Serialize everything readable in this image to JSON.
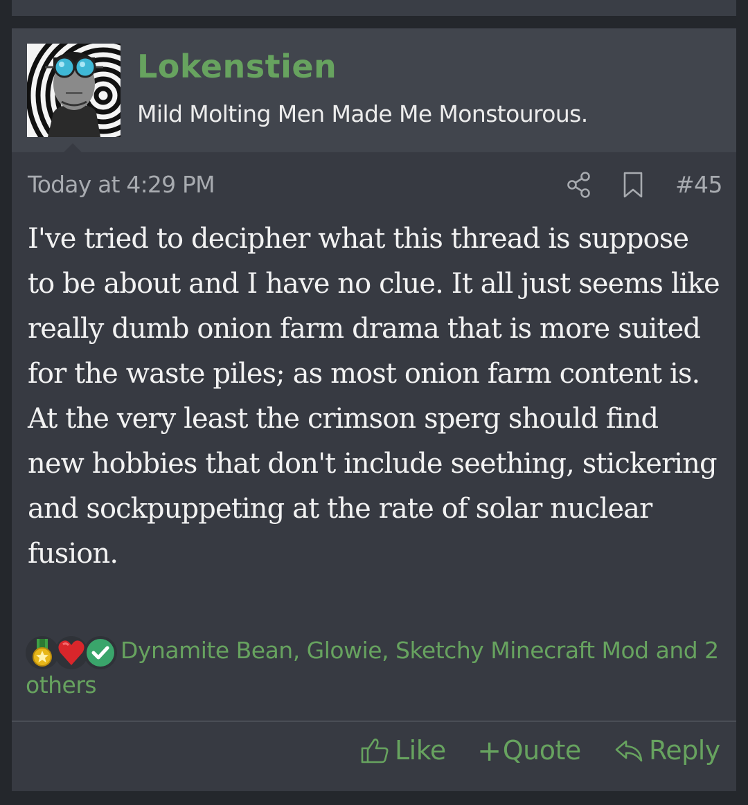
{
  "post": {
    "author": {
      "username": "Lokenstien",
      "user_title": "Mild Molting Men Made Me Monstourous."
    },
    "date": "Today at 4:29 PM",
    "post_number": "#45",
    "body": "I've tried to decipher what this thread is suppose to be about and I have no clue. It all just seems like really dumb onion farm drama that is more suited for the waste piles; as most onion farm content is. At the very least the crimson sperg should find new hobbies that don't include seething, stickering and sockpuppeting at the rate of solar nuclear fusion.",
    "reactions": {
      "icons": [
        "medal-icon",
        "heart-icon",
        "checkmark-icon"
      ],
      "text": "Dynamite Bean, Glowie, Sketchy Minecraft Mod and 2 others"
    },
    "actions": {
      "like": "Like",
      "quote": "Quote",
      "reply": "Reply"
    }
  },
  "colors": {
    "accent": "#67a35f",
    "post_background": "#373a42",
    "header_background": "#41454d",
    "page_background": "#24272c",
    "muted_text": "#a8abb0"
  }
}
